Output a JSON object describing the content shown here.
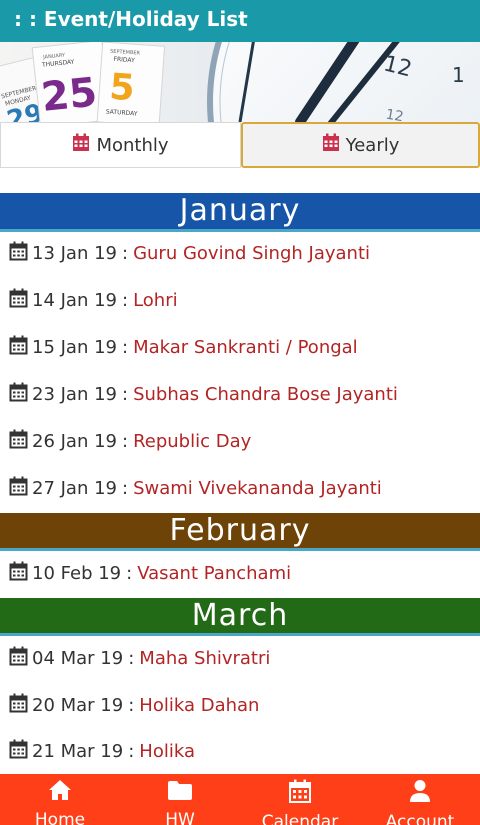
{
  "app_bar": {
    "title": ": : Event/Holiday List"
  },
  "banner": {
    "calendar_pages": [
      {
        "month": "JANUARY",
        "weekday": "THURSDAY",
        "day": "25"
      },
      {
        "month": "SEPTEMBER",
        "weekday": "FRIDAY",
        "day": "5"
      },
      {
        "month": "SEPTEMBER",
        "weekday": "MONDAY",
        "day": "29"
      },
      {
        "weekday": "SATURDAY"
      }
    ],
    "clock_numbers": [
      "12",
      "1",
      "12"
    ]
  },
  "tabs": [
    {
      "label": "Monthly",
      "icon": "calendar-icon",
      "active": false
    },
    {
      "label": "Yearly",
      "icon": "calendar-icon",
      "active": true
    }
  ],
  "months": [
    {
      "name": "January",
      "color": "#1655a8",
      "events": [
        {
          "date": "13 Jan 19",
          "name": "Guru Govind Singh Jayanti"
        },
        {
          "date": "14 Jan 19",
          "name": "Lohri"
        },
        {
          "date": "15 Jan 19",
          "name": "Makar Sankranti / Pongal"
        },
        {
          "date": "23 Jan 19",
          "name": "Subhas Chandra Bose Jayanti"
        },
        {
          "date": "26 Jan 19",
          "name": "Republic Day"
        },
        {
          "date": "27 Jan 19",
          "name": "Swami Vivekananda Jayanti"
        }
      ]
    },
    {
      "name": "February",
      "color": "#6e4308",
      "events": [
        {
          "date": "10 Feb 19",
          "name": "Vasant Panchami"
        }
      ]
    },
    {
      "name": "March",
      "color": "#226a16",
      "events": [
        {
          "date": "04 Mar 19",
          "name": "Maha Shivratri"
        },
        {
          "date": "20 Mar 19",
          "name": "Holika Dahan"
        },
        {
          "date": "21 Mar 19",
          "name": "Holika"
        }
      ]
    }
  ],
  "separator": ":",
  "bottom_nav": [
    {
      "label": "Home",
      "icon": "home-icon"
    },
    {
      "label": "HW",
      "icon": "folder-icon"
    },
    {
      "label": "Calendar",
      "icon": "calendar-icon"
    },
    {
      "label": "Account",
      "icon": "user-icon"
    }
  ],
  "colors": {
    "app_bar": "#1a9aa8",
    "event_name": "#b32424",
    "bottom_nav": "#ff3f17",
    "tab_icon": "#c9314e",
    "yearly_border": "#d9a83a"
  }
}
